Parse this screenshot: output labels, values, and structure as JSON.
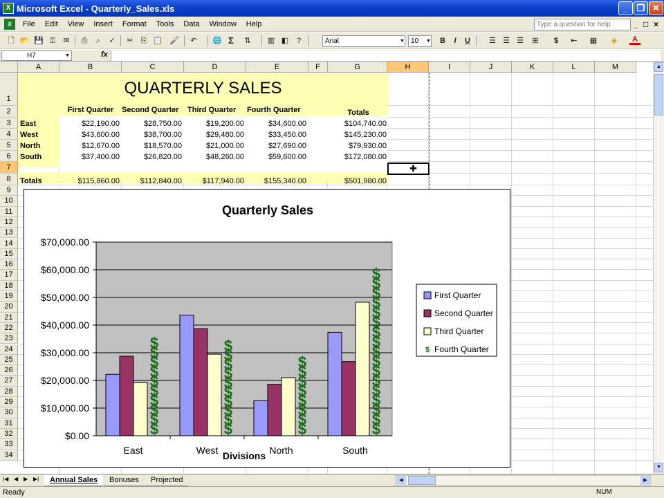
{
  "window": {
    "title": "Microsoft Excel - Quarterly_Sales.xls",
    "app_icon": "X"
  },
  "menu": {
    "items": [
      "File",
      "Edit",
      "View",
      "Insert",
      "Format",
      "Tools",
      "Data",
      "Window",
      "Help"
    ],
    "ask_placeholder": "Type a question for help"
  },
  "toolbar": {
    "font": "Arial",
    "font_size": "10",
    "bold": "B",
    "italic": "I",
    "underline": "U",
    "currency": "$",
    "sum": "Σ"
  },
  "formula_bar": {
    "cell_ref": "H7",
    "fx": "fx",
    "value": ""
  },
  "columns": [
    "A",
    "B",
    "C",
    "D",
    "E",
    "F",
    "G",
    "H",
    "I",
    "J",
    "K",
    "L",
    "M"
  ],
  "rows": [
    "1",
    "2",
    "3",
    "4",
    "5",
    "6",
    "7",
    "8",
    "9",
    "10",
    "11",
    "12",
    "13",
    "14",
    "15",
    "16",
    "17",
    "18",
    "19",
    "20",
    "21",
    "22",
    "23",
    "24",
    "25",
    "26",
    "27",
    "28",
    "29",
    "30",
    "31",
    "32",
    "33",
    "34"
  ],
  "sheet": {
    "title": "QUARTERLY SALES",
    "headers": [
      "First Quarter",
      "Second Quarter",
      "Third Quarter",
      "Fourth Quarter"
    ],
    "totals_header": "Totals",
    "data_rows": [
      {
        "label": "East",
        "values": [
          "$22,190.00",
          "$28,750.00",
          "$19,200.00",
          "$34,600.00"
        ],
        "total": "$104,740.00"
      },
      {
        "label": "West",
        "values": [
          "$43,600.00",
          "$38,700.00",
          "$29,480.00",
          "$33,450.00"
        ],
        "total": "$145,230.00"
      },
      {
        "label": "North",
        "values": [
          "$12,670.00",
          "$18,570.00",
          "$21,000.00",
          "$27,690.00"
        ],
        "total": "$79,930.00"
      },
      {
        "label": "South",
        "values": [
          "$37,400.00",
          "$26,820.00",
          "$48,260.00",
          "$59,600.00"
        ],
        "total": "$172,080.00"
      }
    ],
    "totals_row": {
      "label": "Totals",
      "values": [
        "$115,860.00",
        "$112,840.00",
        "$117,940.00",
        "$155,340.00"
      ],
      "total": "$501,980.00"
    }
  },
  "chart_data": {
    "type": "bar",
    "title": "Quarterly Sales",
    "xlabel": "Divisions",
    "ylabel": "",
    "categories": [
      "East",
      "West",
      "North",
      "South"
    ],
    "ylim": [
      0,
      70000
    ],
    "yticks": [
      "$0.00",
      "$10,000.00",
      "$20,000.00",
      "$30,000.00",
      "$40,000.00",
      "$50,000.00",
      "$60,000.00",
      "$70,000.00"
    ],
    "grid": true,
    "legend": "right",
    "series": [
      {
        "name": "First Quarter",
        "values": [
          22190,
          43600,
          12670,
          37400
        ],
        "color": "#9999ff"
      },
      {
        "name": "Second Quarter",
        "values": [
          28750,
          38700,
          18570,
          26820
        ],
        "color": "#993366"
      },
      {
        "name": "Third Quarter",
        "values": [
          19200,
          29480,
          21000,
          48260
        ],
        "color": "#ffffcc"
      },
      {
        "name": "Fourth Quarter",
        "values": [
          34600,
          33450,
          27690,
          59600
        ],
        "color": "#1a6b1a",
        "fill": "dollar-signs",
        "glyph": "$"
      }
    ]
  },
  "tabs": [
    "Annual Sales",
    "Bonuses",
    "Projected"
  ],
  "status": {
    "left": "Ready",
    "right": "NUM"
  }
}
